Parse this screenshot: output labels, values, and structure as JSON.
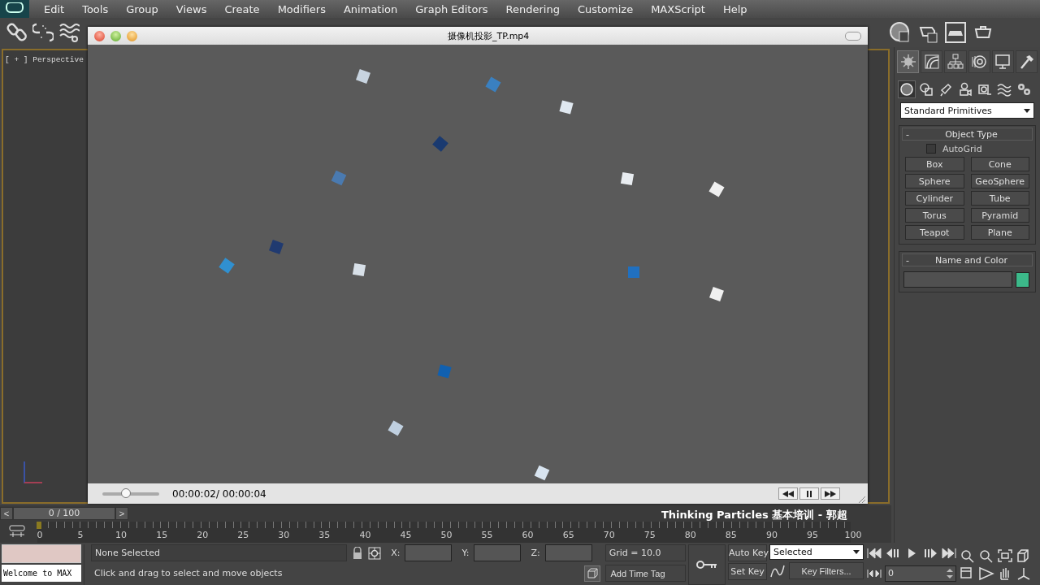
{
  "menu": [
    "Edit",
    "Tools",
    "Group",
    "Views",
    "Create",
    "Modifiers",
    "Animation",
    "Graph Editors",
    "Rendering",
    "Customize",
    "MAXScript",
    "Help"
  ],
  "viewport": {
    "label": "[ + ] Perspective"
  },
  "player": {
    "title": "摄像机投影_TP.mp4",
    "time": "00:00:02/ 00:00:04",
    "seek": {
      "level": 0.4
    }
  },
  "caption": "Thinking Particles 基本培训 - 郭超",
  "command_panel": {
    "tabs": [
      {
        "kind": "sun",
        "selected": true
      },
      {
        "kind": "curve",
        "selected": false
      },
      {
        "kind": "hierarchy",
        "selected": false
      },
      {
        "kind": "motion",
        "selected": false
      },
      {
        "kind": "display",
        "selected": false
      },
      {
        "kind": "hammer",
        "selected": false
      }
    ],
    "categories": [
      {
        "kind": "sphere",
        "selected": true
      },
      {
        "kind": "shapes",
        "selected": false
      },
      {
        "kind": "light",
        "selected": false
      },
      {
        "kind": "camera",
        "selected": false
      },
      {
        "kind": "helper",
        "selected": false
      },
      {
        "kind": "wave",
        "selected": false
      },
      {
        "kind": "gears",
        "selected": false
      }
    ],
    "dropdown": "Standard Primitives",
    "object_type": {
      "collapse": "-",
      "title": "Object Type",
      "autogrid": {
        "label": "AutoGrid",
        "checked": false
      },
      "buttons": [
        "Box",
        "Cone",
        "Sphere",
        "GeoSphere",
        "Cylinder",
        "Tube",
        "Torus",
        "Pyramid",
        "Teapot",
        "Plane"
      ]
    },
    "name_and_color": {
      "collapse": "-",
      "title": "Name and Color"
    }
  },
  "time_slider": {
    "position": "0 / 100",
    "level": 0,
    "prev": "<",
    "next": ">"
  },
  "track_ticks": [
    "0",
    "5",
    "10",
    "15",
    "20",
    "25",
    "30",
    "35",
    "40",
    "45",
    "50",
    "55",
    "60",
    "65",
    "70",
    "75",
    "80",
    "85",
    "90",
    "95",
    "100"
  ],
  "status": {
    "listener": "Welcome to MAX",
    "selection": "None Selected",
    "prompt": "Click and drag to select and move objects",
    "coords": [
      "X:",
      "Y:",
      "Z:"
    ],
    "grid": "Grid = 10.0",
    "add_time_tag": "Add Time Tag",
    "auto_key": "Auto Key",
    "set_key": "Set Key",
    "key_mode": "Selected",
    "key_filters": "Key Filters...",
    "frame": "0"
  }
}
